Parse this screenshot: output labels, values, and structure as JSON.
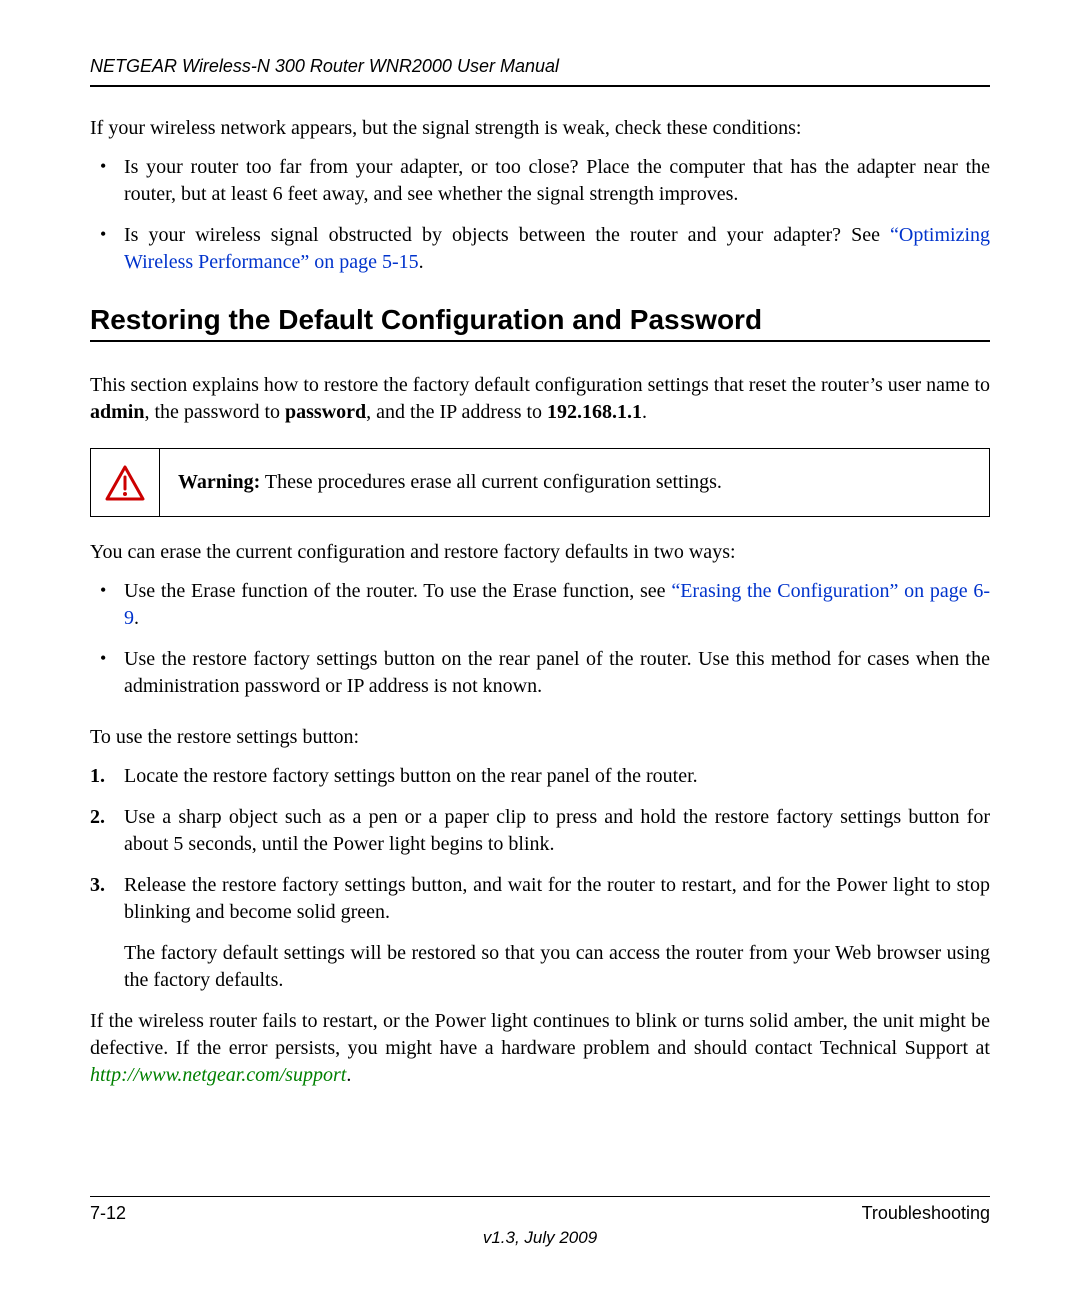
{
  "header": {
    "title": "NETGEAR Wireless-N 300 Router WNR2000 User Manual"
  },
  "intro_para": "If your wireless network appears, but the signal strength is weak, check these conditions:",
  "top_bullets": [
    {
      "text": "Is your router too far from your adapter, or too close? Place the computer that has the adapter near the router, but at least 6 feet away, and see whether the signal strength improves."
    },
    {
      "prefix": "Is your wireless signal obstructed by objects between the router and your adapter? See ",
      "link": "“Optimizing Wireless Performance” on page 5-15",
      "suffix": "."
    }
  ],
  "section_title": "Restoring the Default Configuration and Password",
  "restore_intro": {
    "p1": "This section explains how to restore the factory default configuration settings that reset the router’s user name to ",
    "b1": "admin",
    "p2": ", the password to ",
    "b2": "password",
    "p3": ", and the IP address to ",
    "b3": "192.168.1.1",
    "p4": "."
  },
  "warning": {
    "label": "Warning:",
    "text": " These procedures erase all current configuration settings."
  },
  "ways_intro": "You can erase the current configuration and restore factory defaults in two ways:",
  "ways_bullets": [
    {
      "prefix": "Use the Erase function of the router. To use the Erase function, see ",
      "link": "“Erasing the Configuration” on page 6-9",
      "suffix": "."
    },
    {
      "text": "Use the restore factory settings button on the rear panel of the router. Use this method for cases when the administration password or IP address is not known."
    }
  ],
  "steps_intro": "To use the restore settings button:",
  "steps": [
    {
      "text": "Locate the restore factory settings button on the rear panel of the router."
    },
    {
      "text": "Use a sharp object such as a pen or a paper clip to press and hold the restore factory settings button for about 5 seconds, until the Power light begins to blink."
    },
    {
      "text": "Release the restore factory settings button, and wait for the router to restart, and for the Power light to stop blinking and become solid green.",
      "follow": "The factory default settings will be restored so that you can access the router from your Web browser using the factory defaults."
    }
  ],
  "closing": {
    "prefix": "If the wireless router fails to restart, or the Power light continues to blink or turns solid amber, the unit might be defective. If the error persists, you might have a hardware problem and should contact Technical Support at ",
    "url": "http://www.netgear.com/support",
    "suffix": "."
  },
  "footer": {
    "page_num": "7-12",
    "chapter": "Troubleshooting",
    "version": "v1.3, July 2009"
  }
}
